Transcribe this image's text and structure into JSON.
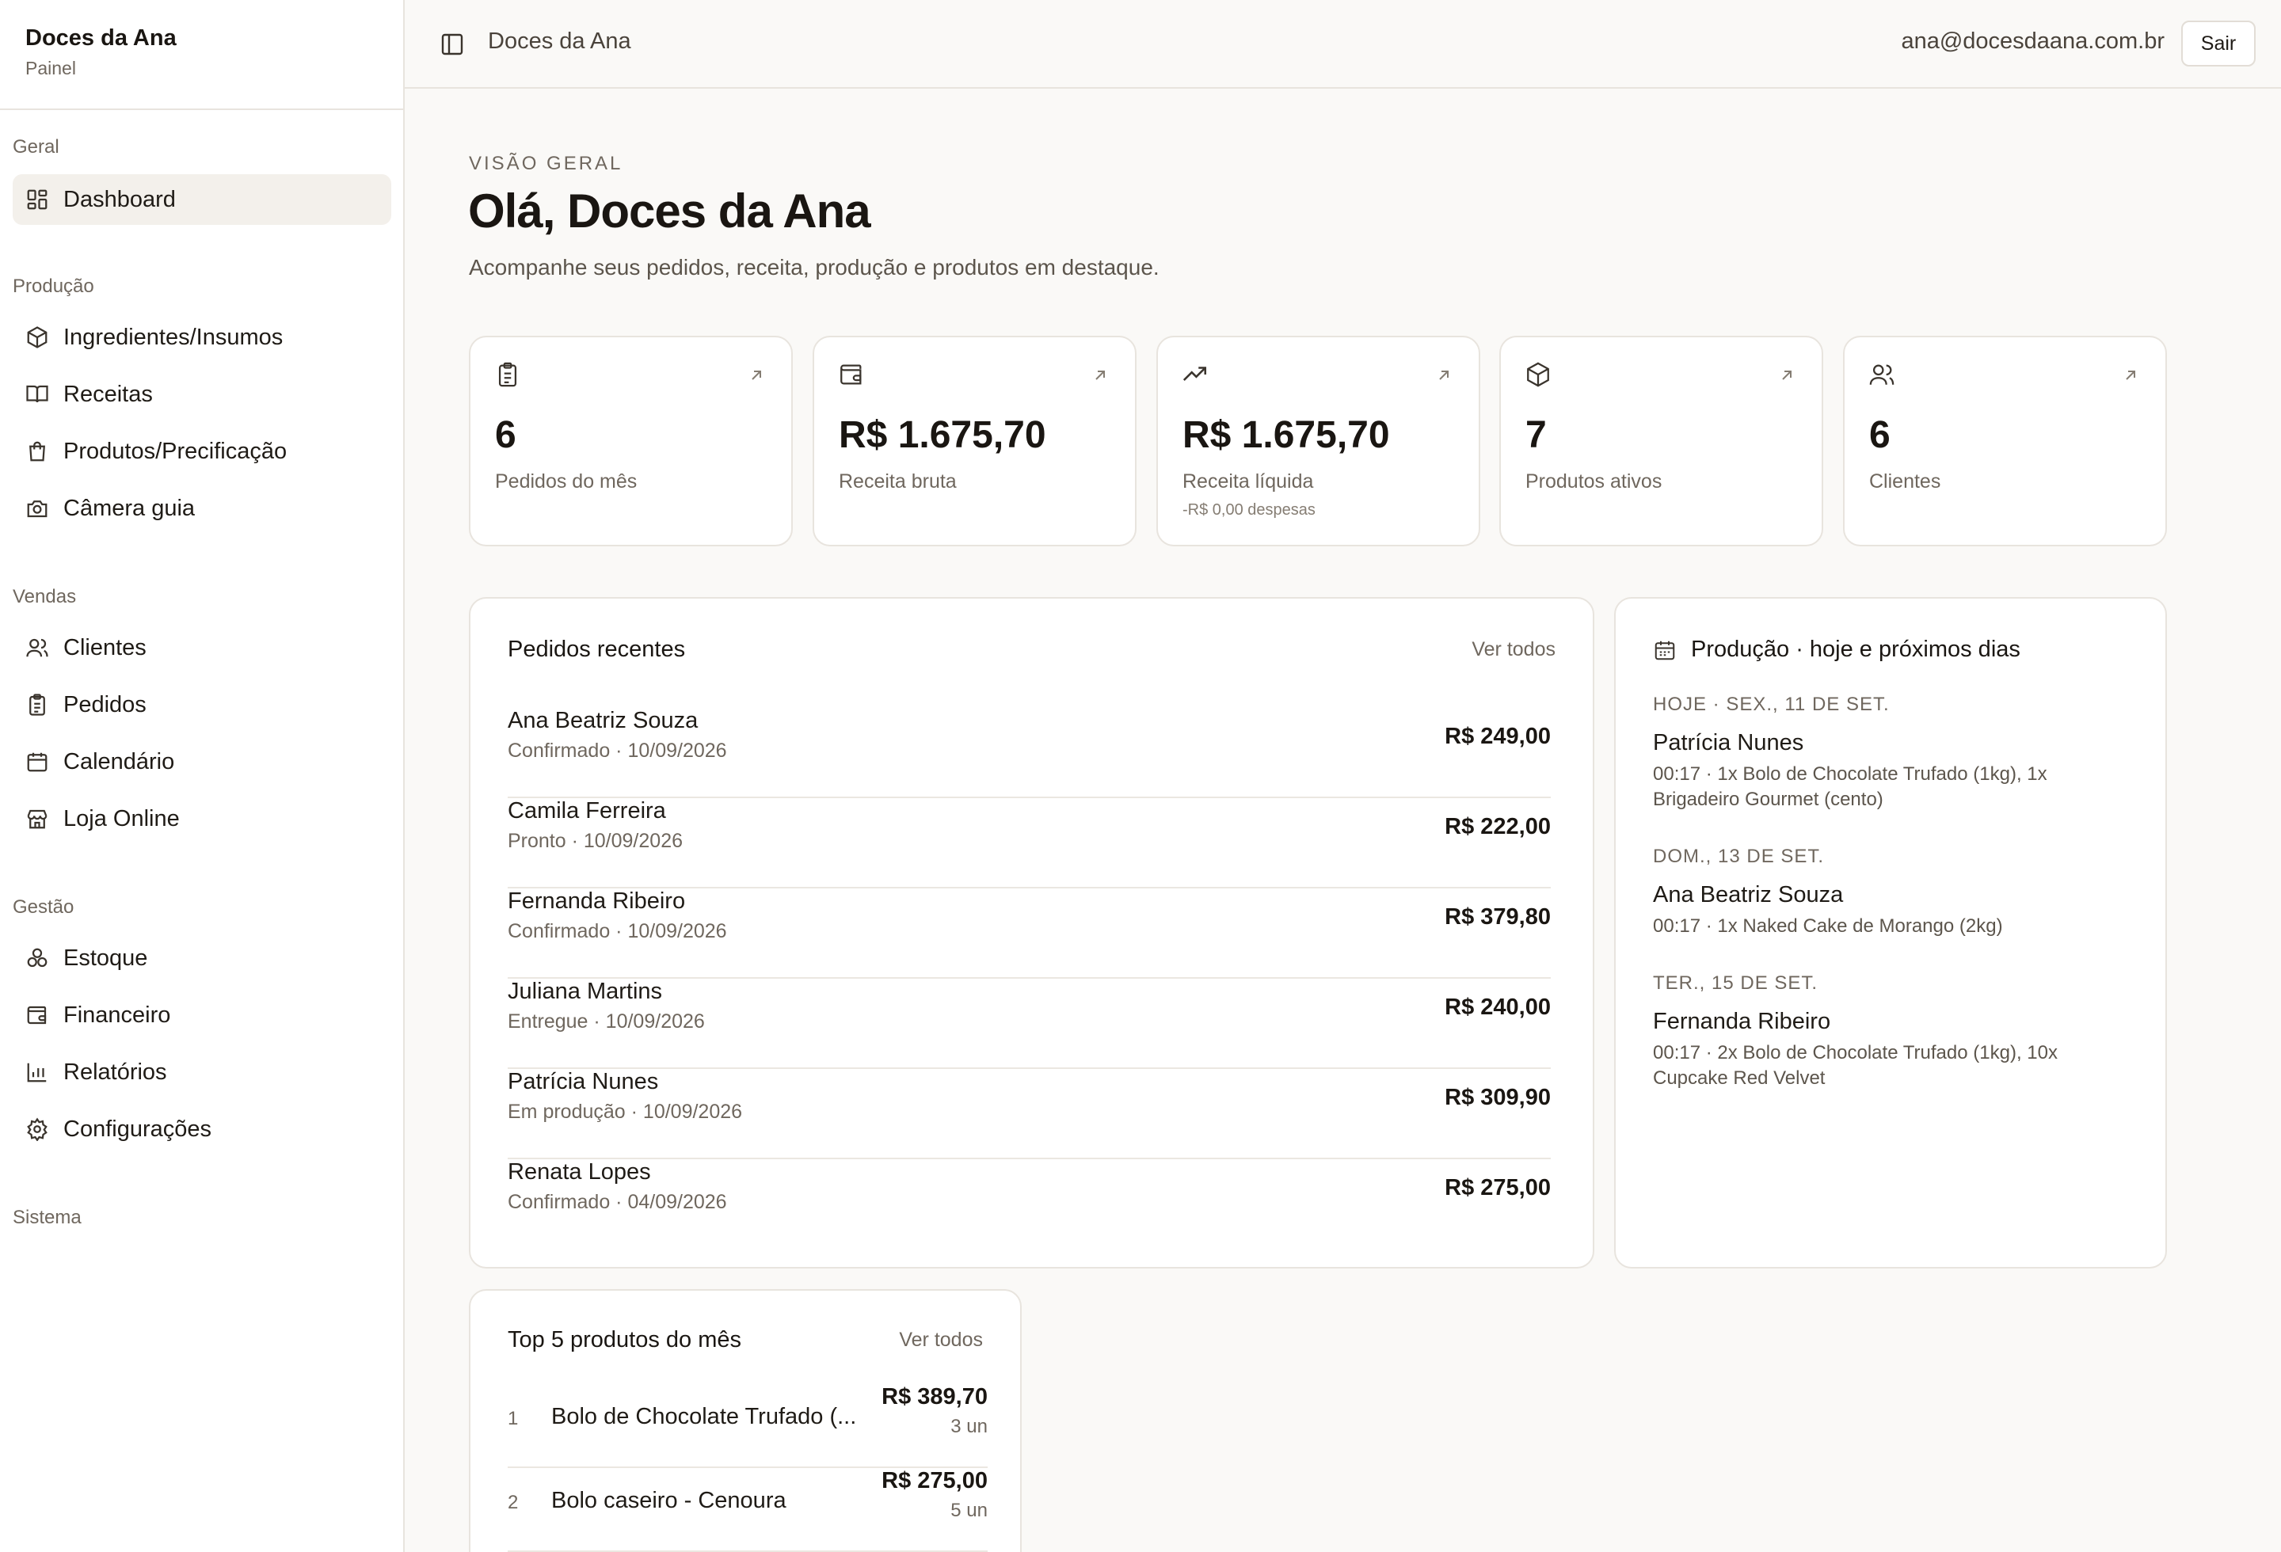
{
  "brand": {
    "name": "Doces da Ana",
    "subtitle": "Painel"
  },
  "sidebar": {
    "groups": [
      {
        "title": "Geral",
        "items": [
          {
            "label": "Dashboard",
            "icon": "grid-icon",
            "active": true
          }
        ]
      },
      {
        "title": "Produção",
        "items": [
          {
            "label": "Ingredientes/Insumos",
            "icon": "package-icon"
          },
          {
            "label": "Receitas",
            "icon": "book-icon"
          },
          {
            "label": "Produtos/Precificação",
            "icon": "shopping-bag-icon"
          },
          {
            "label": "Câmera guia",
            "icon": "camera-icon"
          }
        ]
      },
      {
        "title": "Vendas",
        "items": [
          {
            "label": "Clientes",
            "icon": "users-icon"
          },
          {
            "label": "Pedidos",
            "icon": "clipboard-icon"
          },
          {
            "label": "Calendário",
            "icon": "calendar-icon"
          },
          {
            "label": "Loja Online",
            "icon": "store-icon"
          }
        ]
      },
      {
        "title": "Gestão",
        "items": [
          {
            "label": "Estoque",
            "icon": "boxes-icon"
          },
          {
            "label": "Financeiro",
            "icon": "wallet-icon"
          },
          {
            "label": "Relatórios",
            "icon": "bar-chart-icon"
          },
          {
            "label": "Configurações",
            "icon": "gear-icon"
          }
        ]
      },
      {
        "title": "Sistema",
        "items": []
      }
    ]
  },
  "topbar": {
    "title": "Doces da Ana",
    "email": "ana@docesdaana.com.br",
    "logout_label": "Sair"
  },
  "header": {
    "eyebrow": "VISÃO GERAL",
    "title": "Olá, Doces da Ana",
    "subtitle": "Acompanhe seus pedidos, receita, produção e produtos em destaque."
  },
  "stats": [
    {
      "value": "6",
      "label": "Pedidos do mês",
      "note": "",
      "icon": "clipboard-icon"
    },
    {
      "value": "R$ 1.675,70",
      "label": "Receita bruta",
      "note": "",
      "icon": "wallet-icon"
    },
    {
      "value": "R$ 1.675,70",
      "label": "Receita líquida",
      "note": "-R$ 0,00 despesas",
      "icon": "trending-up-icon"
    },
    {
      "value": "7",
      "label": "Produtos ativos",
      "note": "",
      "icon": "package-icon"
    },
    {
      "value": "6",
      "label": "Clientes",
      "note": "",
      "icon": "users-icon"
    }
  ],
  "recent_orders": {
    "title": "Pedidos recentes",
    "link": "Ver todos",
    "rows": [
      {
        "name": "Ana Beatriz Souza",
        "meta": "Confirmado · 10/09/2026",
        "value": "R$ 249,00"
      },
      {
        "name": "Camila Ferreira",
        "meta": "Pronto · 10/09/2026",
        "value": "R$ 222,00"
      },
      {
        "name": "Fernanda Ribeiro",
        "meta": "Confirmado · 10/09/2026",
        "value": "R$ 379,80"
      },
      {
        "name": "Juliana Martins",
        "meta": "Entregue · 10/09/2026",
        "value": "R$ 240,00"
      },
      {
        "name": "Patrícia Nunes",
        "meta": "Em produção · 10/09/2026",
        "value": "R$ 309,90"
      },
      {
        "name": "Renata Lopes",
        "meta": "Confirmado · 04/09/2026",
        "value": "R$ 275,00"
      }
    ]
  },
  "production": {
    "title": "Produção · hoje e próximos dias",
    "days": [
      {
        "day": "HOJE · SEX., 11 DE SET.",
        "client": "Patrícia Nunes",
        "detail": "00:17 · 1x Bolo de Chocolate Trufado (1kg), 1x Brigadeiro Gourmet (cento)"
      },
      {
        "day": "DOM., 13 DE SET.",
        "client": "Ana Beatriz Souza",
        "detail": "00:17 · 1x Naked Cake de Morango (2kg)"
      },
      {
        "day": "TER., 15 DE SET.",
        "client": "Fernanda Ribeiro",
        "detail": "00:17 · 2x Bolo de Chocolate Trufado (1kg), 10x Cupcake Red Velvet"
      }
    ]
  },
  "top_products": {
    "title": "Top 5 produtos do mês",
    "link": "Ver todos",
    "rows": [
      {
        "rank": "1",
        "name": "Bolo de Chocolate Trufado (...",
        "price": "R$ 389,70",
        "qty": "3 un"
      },
      {
        "rank": "2",
        "name": "Bolo caseiro - Cenoura",
        "price": "R$ 275,00",
        "qty": "5 un"
      }
    ]
  }
}
